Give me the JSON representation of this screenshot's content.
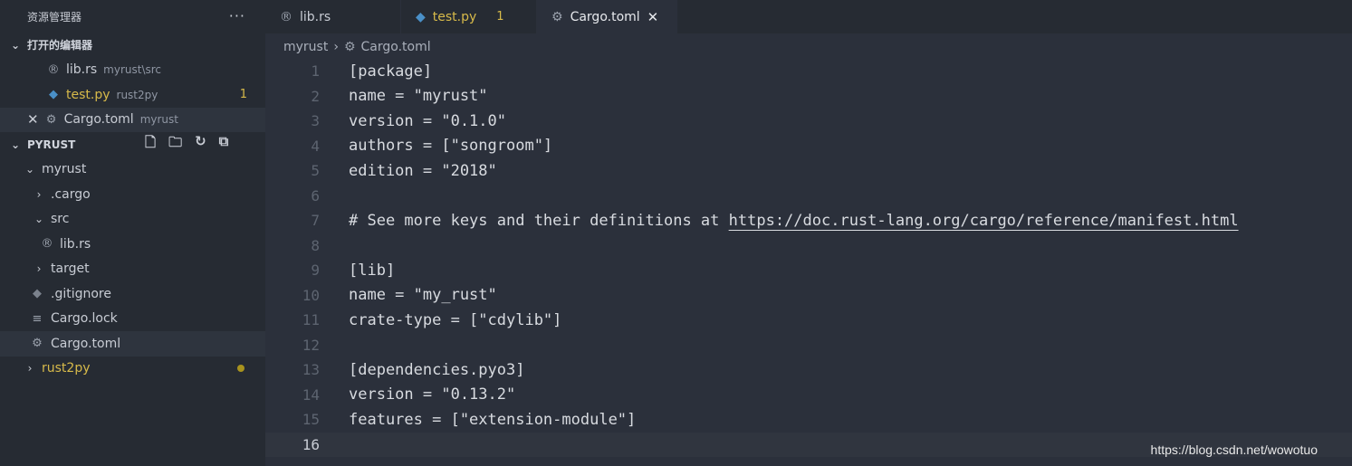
{
  "sidebar": {
    "title": "资源管理器",
    "more": "···",
    "open_editors": {
      "label": "打开的编辑器",
      "items": [
        {
          "name": "lib.rs",
          "desc": "myrust\\src",
          "badge": ""
        },
        {
          "name": "test.py",
          "desc": "rust2py",
          "badge": "1"
        },
        {
          "name": "Cargo.toml",
          "desc": "myrust",
          "badge": ""
        }
      ]
    },
    "workspace": {
      "label": "PYRUST",
      "tree": [
        {
          "name": "myrust"
        },
        {
          "name": ".cargo"
        },
        {
          "name": "src"
        },
        {
          "name": "lib.rs"
        },
        {
          "name": "target"
        },
        {
          "name": ".gitignore"
        },
        {
          "name": "Cargo.lock"
        },
        {
          "name": "Cargo.toml"
        },
        {
          "name": "rust2py"
        }
      ]
    }
  },
  "tabs": [
    {
      "label": "lib.rs",
      "badge": ""
    },
    {
      "label": "test.py",
      "badge": "1"
    },
    {
      "label": "Cargo.toml",
      "badge": ""
    }
  ],
  "breadcrumb": {
    "folder": "myrust",
    "file": "Cargo.toml"
  },
  "editor": {
    "lines": [
      {
        "n": "1",
        "code": "[package]"
      },
      {
        "n": "2",
        "code": "name = \"myrust\""
      },
      {
        "n": "3",
        "code": "version = \"0.1.0\""
      },
      {
        "n": "4",
        "code": "authors = [\"songroom\"]"
      },
      {
        "n": "5",
        "code": "edition = \"2018\""
      },
      {
        "n": "6",
        "code": ""
      },
      {
        "n": "7",
        "code": "# See more keys and their definitions at ",
        "link": "https://doc.rust-lang.org/cargo/reference/manifest.html"
      },
      {
        "n": "8",
        "code": ""
      },
      {
        "n": "9",
        "code": "[lib]"
      },
      {
        "n": "10",
        "code": "name = \"my_rust\""
      },
      {
        "n": "11",
        "code": "crate-type = [\"cdylib\"]"
      },
      {
        "n": "12",
        "code": ""
      },
      {
        "n": "13",
        "code": "[dependencies.pyo3]"
      },
      {
        "n": "14",
        "code": "version = \"0.13.2\""
      },
      {
        "n": "15",
        "code": "features = [\"extension-module\"]"
      },
      {
        "n": "16",
        "code": ""
      }
    ]
  },
  "watermark": "https://blog.csdn.net/wowotuo",
  "colors": {
    "accent_yellow": "#d7ba4a",
    "python_blue": "#4a90c8",
    "editor_bg": "#2b303b",
    "sidebar_bg": "#262b33"
  }
}
